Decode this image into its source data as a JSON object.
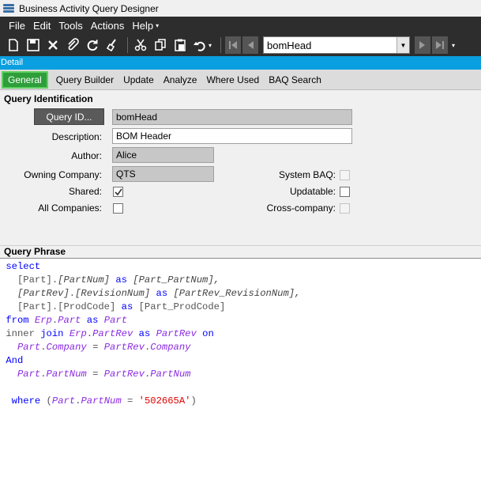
{
  "window": {
    "title": "Business Activity Query Designer"
  },
  "menu": {
    "items": [
      "File",
      "Edit",
      "Tools",
      "Actions",
      "Help"
    ]
  },
  "toolbar": {
    "buttons": [
      "new-icon",
      "save-icon",
      "delete-icon",
      "attach-icon",
      "refresh-icon",
      "clear-icon",
      "cut-icon",
      "copy-icon",
      "paste-icon",
      "undo-icon"
    ],
    "record_value": "bomHead"
  },
  "detail_label": "Detail",
  "tabs": [
    "General",
    "Query Builder",
    "Update",
    "Analyze",
    "Where Used",
    "BAQ Search"
  ],
  "query_identification": {
    "section_title": "Query Identification",
    "query_id_button": "Query ID...",
    "query_id_value": "bomHead",
    "description_label": "Description:",
    "description_value": "BOM Header",
    "author_label": "Author:",
    "author_value": "Alice",
    "owning_company_label": "Owning Company:",
    "owning_company_value": "QTS",
    "shared_label": "Shared:",
    "shared_checked": true,
    "all_companies_label": "All Companies:",
    "all_companies_checked": false,
    "system_baq_label": "System BAQ:",
    "system_baq_checked": false,
    "updatable_label": "Updatable:",
    "updatable_checked": false,
    "cross_company_label": "Cross-company:",
    "cross_company_checked": false
  },
  "query_phrase": {
    "section_title": "Query Phrase",
    "lines": {
      "l1": "select",
      "l2a": "[Part]",
      "l2b": ".",
      "l2c": "[PartNum]",
      "l2d": "as",
      "l2e": "[Part_PartNum],",
      "l3a": "[PartRev]",
      "l3b": ".",
      "l3c": "[RevisionNum]",
      "l3d": "as",
      "l3e": "[PartRev_RevisionNum],",
      "l4a": "[Part]",
      "l4b": ".",
      "l4c": "[ProdCode]",
      "l4d": "as",
      "l4e": "[Part_ProdCode]",
      "l5a": "from",
      "l5b": "Erp",
      "l5c": ".",
      "l5d": "Part",
      "l5e": "as",
      "l5f": "Part",
      "l6a": "inner",
      "l6b": "join",
      "l6c": "Erp",
      "l6d": ".",
      "l6e": "PartRev",
      "l6f": "as",
      "l6g": "PartRev",
      "l6h": "on",
      "l7a": "Part",
      "l7b": ".",
      "l7c": "Company",
      "l7d": "=",
      "l7e": "PartRev",
      "l7f": ".",
      "l7g": "Company",
      "l8": "And",
      "l9a": "Part",
      "l9b": ".",
      "l9c": "PartNum",
      "l9d": "=",
      "l9e": "PartRev",
      "l9f": ".",
      "l9g": "PartNum",
      "l10a": "where",
      "l10b": "(",
      "l10c": "Part",
      "l10d": ".",
      "l10e": "PartNum",
      "l10f": "=",
      "l10g": "'502665A'",
      "l10h": ")"
    }
  },
  "colors": {
    "menu_background": "#2d2d2d",
    "detail_bar": "#0a9fe0",
    "active_tab": "#2e9e3a",
    "sql_keyword": "#0000ff",
    "sql_string": "#e00000",
    "sql_alias": "#8a2be2"
  }
}
